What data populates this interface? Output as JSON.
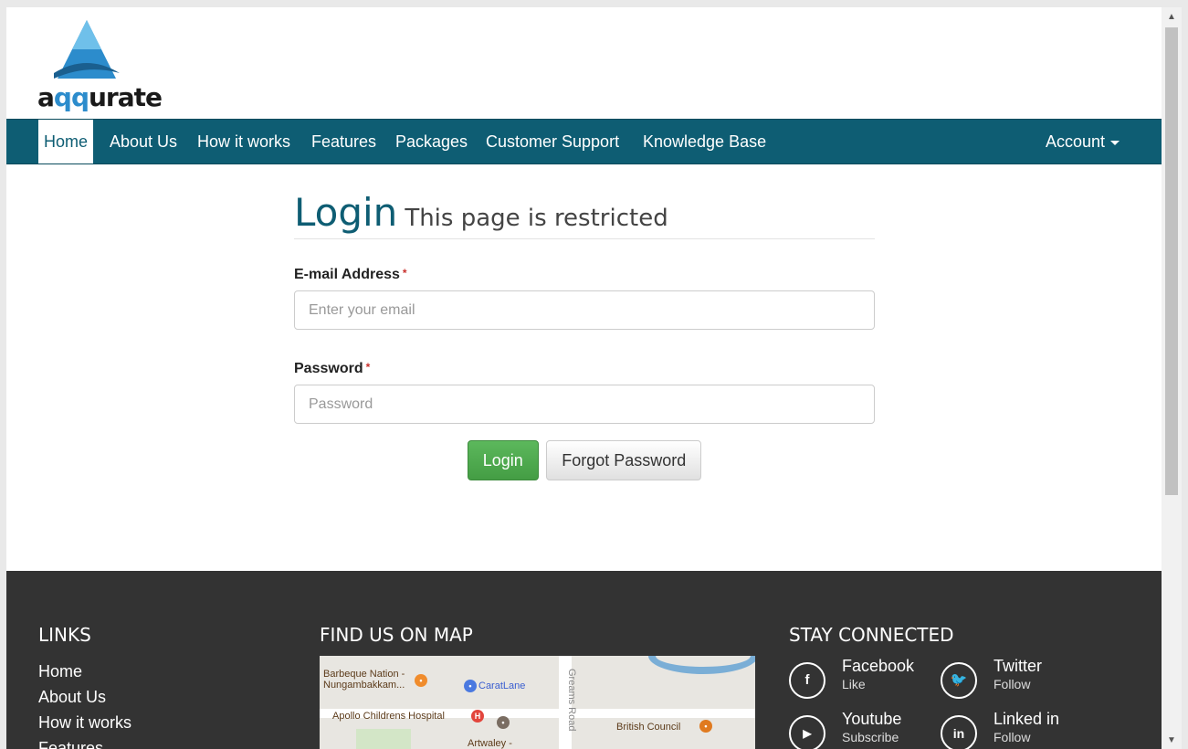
{
  "logo": {
    "text_prefix": "a",
    "text_q": "qq",
    "text_suffix": "urate",
    "brand_color": "#2c8ccc"
  },
  "nav": {
    "items": [
      {
        "label": "Home"
      },
      {
        "label": "About Us"
      },
      {
        "label": "How it works"
      },
      {
        "label": "Features"
      },
      {
        "label": "Packages"
      },
      {
        "label": "Customer Support"
      },
      {
        "label": "Knowledge Base"
      }
    ],
    "account": "Account",
    "bg_color": "#0e5d73"
  },
  "login": {
    "title": "Login",
    "subtitle": "This page is restricted",
    "email_label": "E-mail Address",
    "email_placeholder": "Enter your email",
    "password_label": "Password",
    "password_placeholder": "Password",
    "required_mark": "*",
    "login_button": "Login",
    "forgot_button": "Forgot Password"
  },
  "footer": {
    "links_heading": "LINKS",
    "links": [
      "Home",
      "About Us",
      "How it works",
      "Features"
    ],
    "map_heading": "FIND US ON MAP",
    "map_labels": {
      "barbeque": "Barbeque Nation -",
      "barbeque2": "Nungambakkam...",
      "caratlane": "CaratLane",
      "apollo": "Apollo Childrens Hospital",
      "greams": "Greams Road",
      "british": "British Council",
      "artwaley": "Artwaley -"
    },
    "social_heading": "STAY CONNECTED",
    "social": [
      {
        "name": "Facebook",
        "action": "Like",
        "icon": "facebook-icon",
        "glyph": "f"
      },
      {
        "name": "Twitter",
        "action": "Follow",
        "icon": "twitter-icon",
        "glyph": "t"
      },
      {
        "name": "Youtube",
        "action": "Subscribe",
        "icon": "youtube-icon",
        "glyph": "▶"
      },
      {
        "name": "Linked in",
        "action": "Follow",
        "icon": "linkedin-icon",
        "glyph": "in"
      }
    ],
    "bg_color": "#333333"
  }
}
